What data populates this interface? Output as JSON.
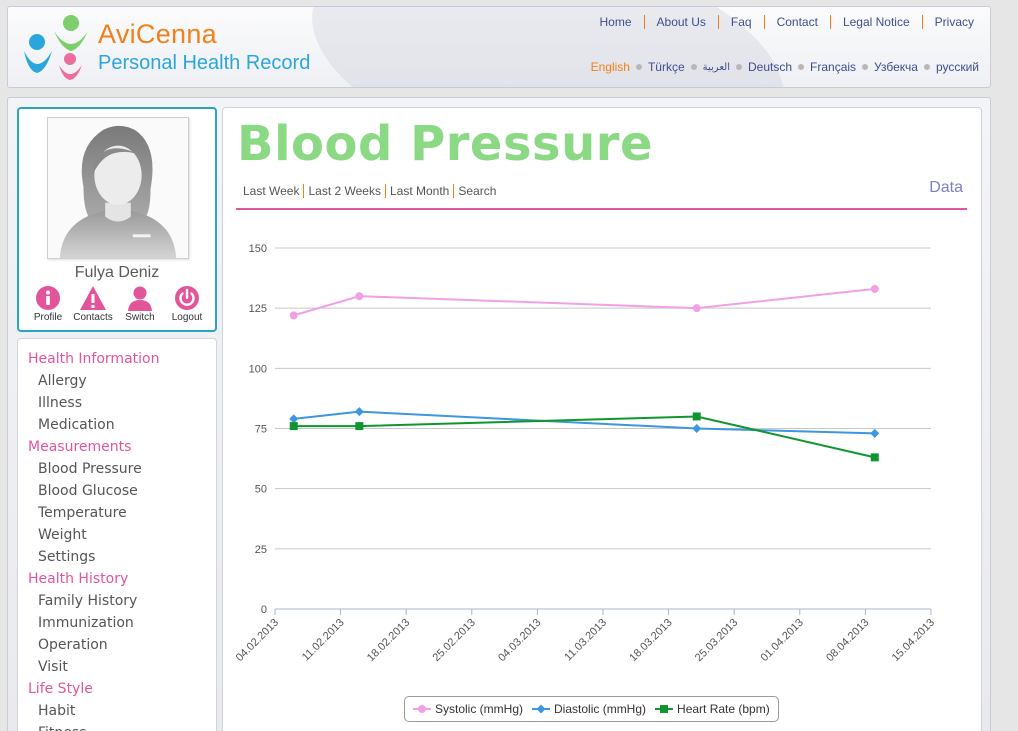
{
  "brand": {
    "name": "AviCenna",
    "subtitle": "Personal Health Record"
  },
  "top_nav": [
    "Home",
    "About Us",
    "Faq",
    "Contact",
    "Legal Notice",
    "Privacy"
  ],
  "languages": {
    "items": [
      "English",
      "Türkçe",
      "العربية",
      "Deutsch",
      "Français",
      "Узбекча",
      "русский"
    ],
    "active": "English"
  },
  "profile": {
    "name": "Fulya Deniz",
    "actions": [
      "Profile",
      "Contacts",
      "Switch",
      "Logout"
    ],
    "action_color": "#e2559b"
  },
  "sidebar": [
    {
      "category": "Health Information",
      "items": [
        "Allergy",
        "Illness",
        "Medication"
      ]
    },
    {
      "category": "Measurements",
      "items": [
        "Blood Pressure",
        "Blood Glucose",
        "Temperature",
        "Weight",
        "Settings"
      ]
    },
    {
      "category": "Health History",
      "items": [
        "Family History",
        "Immunization",
        "Operation",
        "Visit"
      ]
    },
    {
      "category": "Life Style",
      "items": [
        "Habit",
        "Fitness"
      ]
    }
  ],
  "page": {
    "title": "Blood Pressure",
    "filters": [
      "Last Week",
      "Last 2 Weeks",
      "Last Month",
      "Search"
    ],
    "data_link": "Data"
  },
  "colors": {
    "accent_pink": "#e2559b",
    "title_green": "#8bd885",
    "orange": "#f0801c",
    "blue": "#2ba6dc"
  },
  "chart_data": {
    "type": "line",
    "x_ticks": [
      "04.02.2013",
      "11.02.2013",
      "18.02.2013",
      "25.02.2013",
      "04.03.2013",
      "11.03.2013",
      "18.03.2013",
      "25.03.2013",
      "01.04.2013",
      "08.04.2013",
      "15.04.2013"
    ],
    "ylim": [
      0,
      150
    ],
    "y_ticks": [
      0,
      25,
      50,
      75,
      100,
      125,
      150
    ],
    "grid": true,
    "legend_position": "bottom",
    "series": [
      {
        "name": "Systolic (mmHg)",
        "color": "#f2a0e6",
        "marker": "circle",
        "points": [
          [
            "2013-02-06",
            122
          ],
          [
            "2013-02-13",
            130
          ],
          [
            "2013-03-21",
            125
          ],
          [
            "2013-04-09",
            133
          ]
        ]
      },
      {
        "name": "Diastolic (mmHg)",
        "color": "#3c96e0",
        "marker": "diamond",
        "points": [
          [
            "2013-02-06",
            79
          ],
          [
            "2013-02-13",
            82
          ],
          [
            "2013-03-21",
            75
          ],
          [
            "2013-04-09",
            73
          ]
        ]
      },
      {
        "name": "Heart Rate (bpm)",
        "color": "#11962f",
        "marker": "square",
        "points": [
          [
            "2013-02-06",
            76
          ],
          [
            "2013-02-13",
            76
          ],
          [
            "2013-03-21",
            80
          ],
          [
            "2013-04-09",
            63
          ]
        ]
      }
    ]
  }
}
